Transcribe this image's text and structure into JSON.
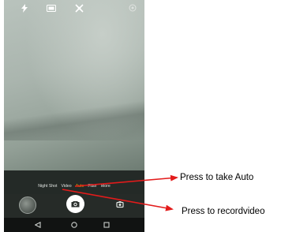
{
  "camera": {
    "modes": [
      "Night Shot",
      "Video",
      "Auto",
      "Filter",
      "More"
    ],
    "active_mode": "Auto"
  },
  "annotations": {
    "auto_label": "Press to take Auto",
    "video_label": "Press to recordvideo"
  },
  "colors": {
    "active_mode": "#f0a500",
    "arrow": "#e31b1b"
  },
  "icons": {
    "flash": "flash-icon",
    "hdr": "hdr-icon",
    "effects": "effects-icon",
    "settings": "settings-icon",
    "shutter": "camera-icon",
    "switch": "switch-camera-icon",
    "back": "back-icon",
    "home": "home-icon",
    "recents": "recents-icon"
  }
}
